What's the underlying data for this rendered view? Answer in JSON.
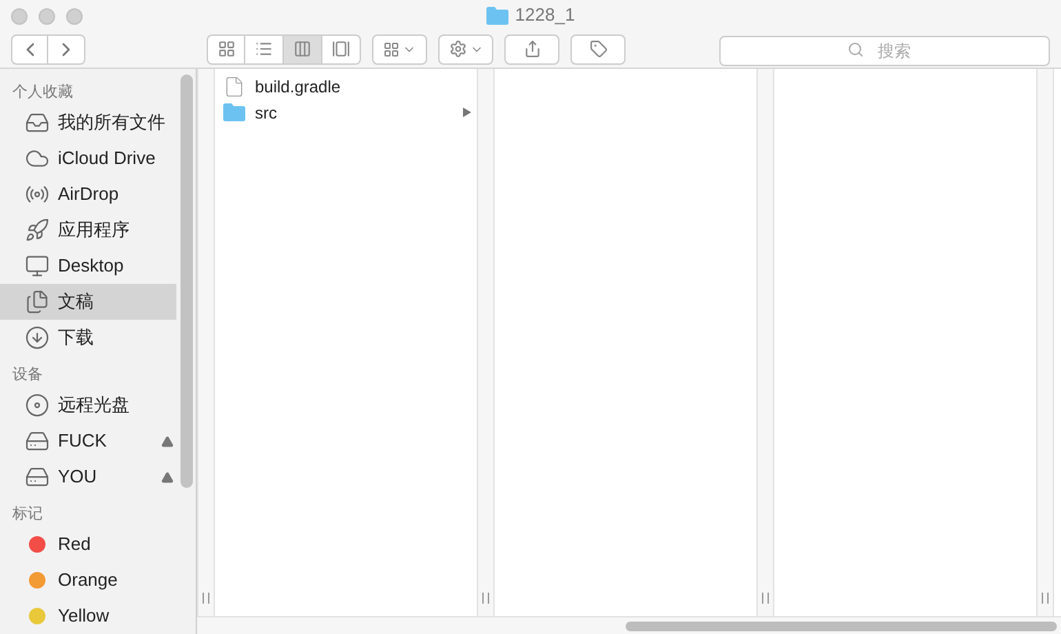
{
  "window": {
    "title": "1228_1"
  },
  "toolbar": {
    "view_modes": [
      {
        "kind": "icons",
        "selected": false
      },
      {
        "kind": "list",
        "selected": false
      },
      {
        "kind": "columns",
        "selected": true
      },
      {
        "kind": "coverflow",
        "selected": false
      }
    ],
    "search": {
      "placeholder": "搜索"
    }
  },
  "sidebar": {
    "sections": [
      {
        "title": "个人收藏",
        "items": [
          {
            "label": "我的所有文件",
            "kind": "all-files",
            "selected": false
          },
          {
            "label": "iCloud Drive",
            "kind": "cloud",
            "selected": false
          },
          {
            "label": "AirDrop",
            "kind": "airdrop",
            "selected": false
          },
          {
            "label": "应用程序",
            "kind": "apps",
            "selected": false
          },
          {
            "label": "Desktop",
            "kind": "desktop",
            "selected": false
          },
          {
            "label": "文稿",
            "kind": "documents",
            "selected": true
          },
          {
            "label": "下载",
            "kind": "downloads",
            "selected": false
          }
        ]
      },
      {
        "title": "设备",
        "items": [
          {
            "label": "远程光盘",
            "kind": "disc",
            "selected": false,
            "ejectable": false
          },
          {
            "label": "FUCK",
            "kind": "drive",
            "selected": false,
            "ejectable": true
          },
          {
            "label": "YOU",
            "kind": "drive",
            "selected": false,
            "ejectable": true
          }
        ]
      },
      {
        "title": "标记",
        "items": [
          {
            "label": "Red",
            "kind": "tag",
            "color": "#f24d47",
            "selected": false
          },
          {
            "label": "Orange",
            "kind": "tag",
            "color": "#f29a33",
            "selected": false
          },
          {
            "label": "Yellow",
            "kind": "tag",
            "color": "#e9c83a",
            "selected": false
          }
        ]
      }
    ]
  },
  "files": [
    {
      "name": "build.gradle",
      "kind": "file",
      "has_children": false
    },
    {
      "name": "src",
      "kind": "folder",
      "has_children": true
    }
  ]
}
